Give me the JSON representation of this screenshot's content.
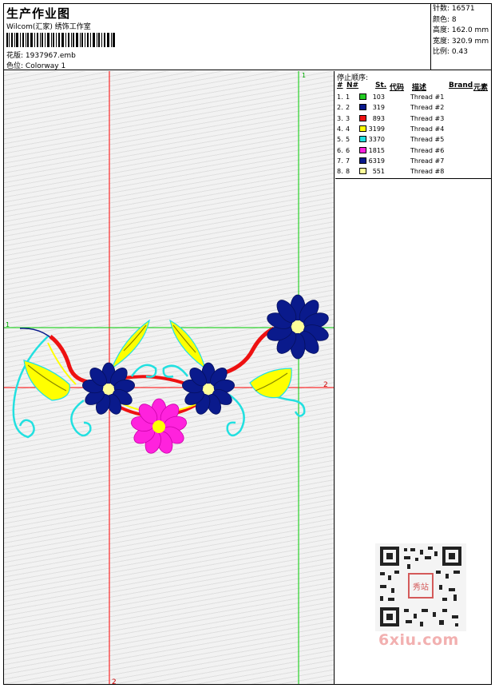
{
  "header": {
    "title": "生产作业图",
    "subtitle": "Wilcom(汇家) 绣饰工作室",
    "design_label": "花版:",
    "design_file": "1937967.emb",
    "colorway_label": "色位:",
    "colorway": "Colorway 1"
  },
  "stats": {
    "stitches_label": "针数:",
    "stitches": "16571",
    "colors_label": "颜色:",
    "colors": "8",
    "height_label": "高度:",
    "height": "162.0 mm",
    "width_label": "宽度:",
    "width": "320.9 mm",
    "scale_label": "比例:",
    "scale": "0.43"
  },
  "guides": {
    "green_1_top": "1",
    "green_1_left": "1",
    "red_2_right": "2",
    "red_2_bottom": "2"
  },
  "stop_sequence": {
    "label": "停止顺序:",
    "columns": {
      "num": "#",
      "n": "N#",
      "st": "St.",
      "code": "代码",
      "desc": "描述",
      "brand": "Brand",
      "element": "元素"
    },
    "rows": [
      {
        "num": "1.",
        "n": "1",
        "code": "103",
        "desc": "Thread #1",
        "color": "#22cc22"
      },
      {
        "num": "2.",
        "n": "2",
        "code": "319",
        "desc": "Thread #2",
        "color": "#0a1a8c"
      },
      {
        "num": "3.",
        "n": "3",
        "code": "893",
        "desc": "Thread #3",
        "color": "#ee1111"
      },
      {
        "num": "4.",
        "n": "4",
        "code": "3199",
        "desc": "Thread #4",
        "color": "#ffff00"
      },
      {
        "num": "5.",
        "n": "5",
        "code": "3370",
        "desc": "Thread #5",
        "color": "#22e0e0"
      },
      {
        "num": "6.",
        "n": "6",
        "code": "1815",
        "desc": "Thread #6",
        "color": "#ff22dd"
      },
      {
        "num": "7.",
        "n": "7",
        "code": "6319",
        "desc": "Thread #7",
        "color": "#0a1a8c"
      },
      {
        "num": "8.",
        "n": "8",
        "code": "551",
        "desc": "Thread #8",
        "color": "#ffff99"
      }
    ]
  },
  "watermark": {
    "brand": "6xiu.com",
    "seal": "秀站"
  }
}
